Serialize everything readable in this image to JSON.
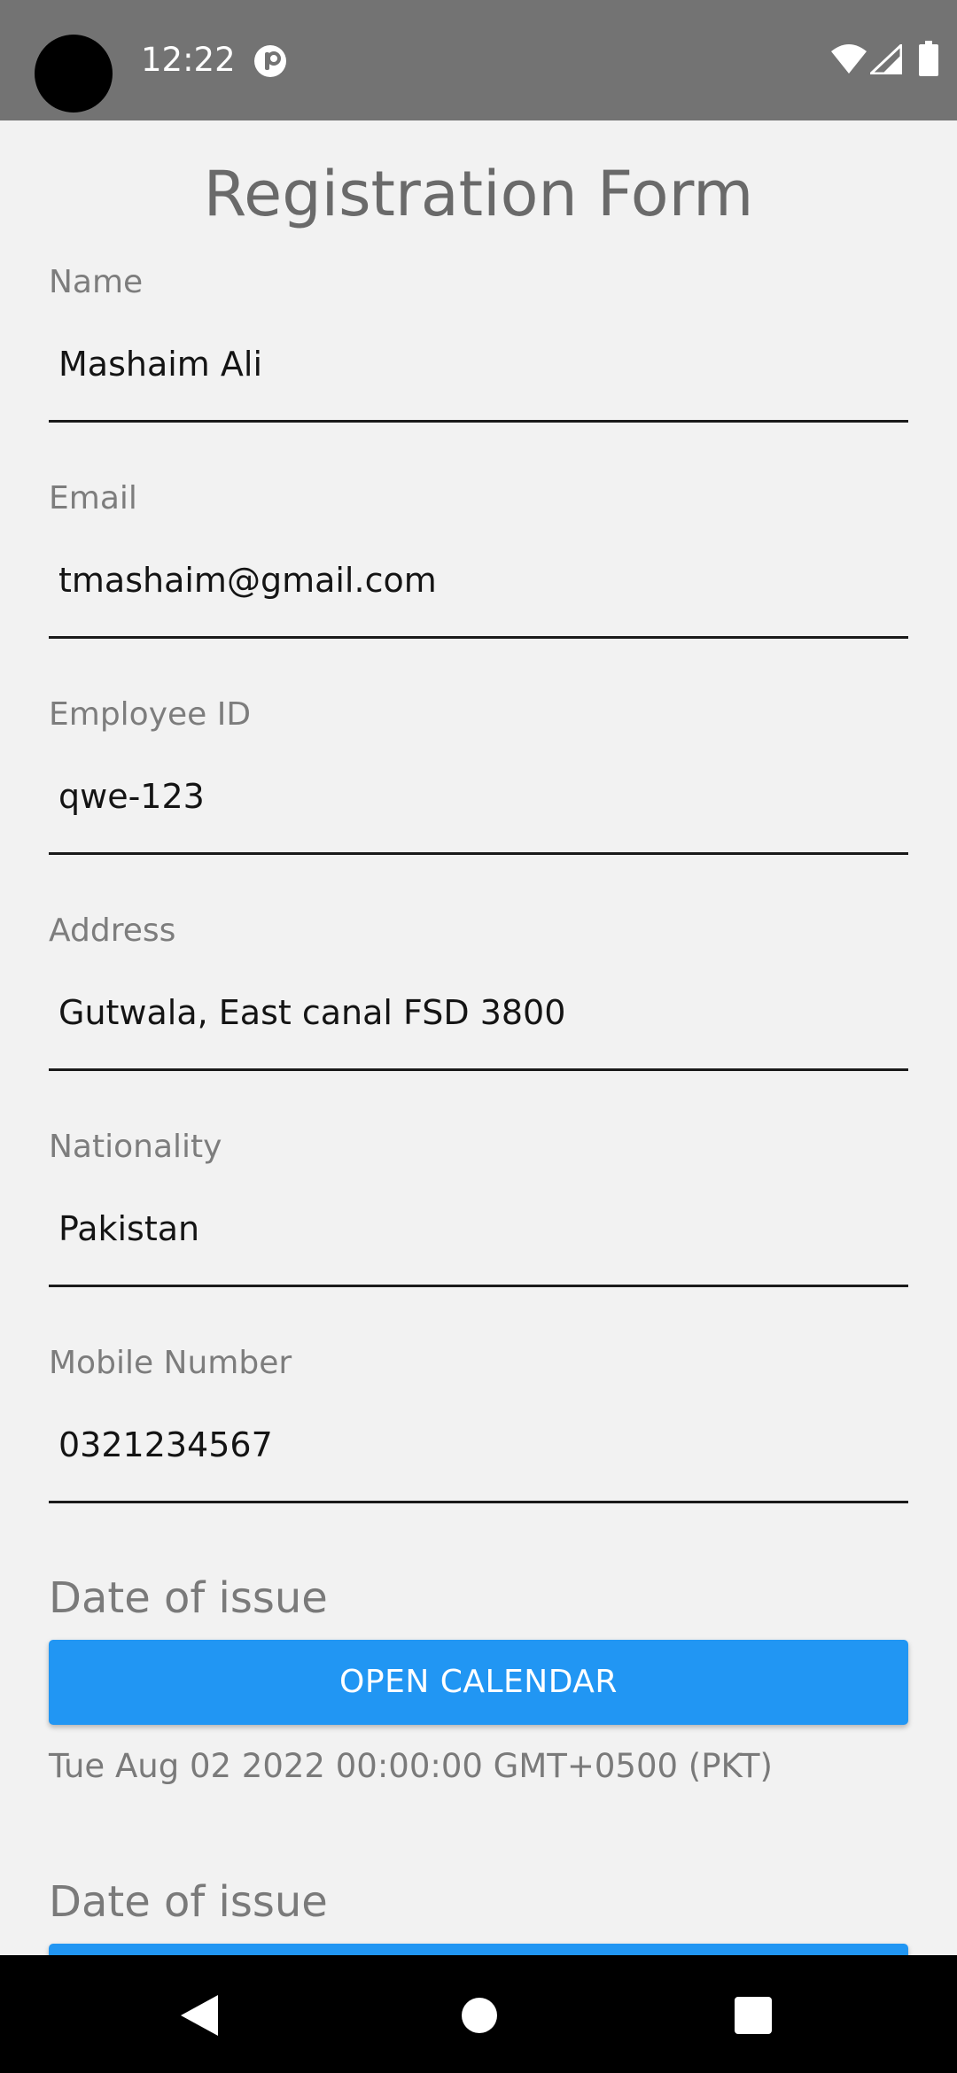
{
  "status_bar": {
    "time": "12:22",
    "icons": [
      "camera-cutout",
      "app-notification-icon",
      "wifi-icon",
      "signal-icon",
      "battery-icon"
    ]
  },
  "form": {
    "title": "Registration Form",
    "fields": [
      {
        "label": "Name",
        "value": "Mashaim Ali"
      },
      {
        "label": "Email",
        "value": "tmashaim@gmail.com"
      },
      {
        "label": "Employee ID",
        "value": "qwe-123"
      },
      {
        "label": "Address",
        "value": "Gutwala, East canal FSD 3800"
      },
      {
        "label": "Nationality",
        "value": "Pakistan"
      },
      {
        "label": "Mobile Number",
        "value": "0321234567"
      }
    ],
    "date_sections": [
      {
        "heading": "Date of issue",
        "button_label": "OPEN CALENDAR",
        "selected_date": "Tue Aug 02 2022 00:00:00 GMT+0500 (PKT)"
      },
      {
        "heading": "Date of issue",
        "button_label": ""
      }
    ]
  },
  "nav_bar": {
    "icons": [
      "back-icon",
      "home-icon",
      "recents-icon"
    ]
  },
  "colors": {
    "status_bar": "#737373",
    "background": "#f2f2f2",
    "accent_button": "#2196f3",
    "nav_bar": "#000000"
  }
}
